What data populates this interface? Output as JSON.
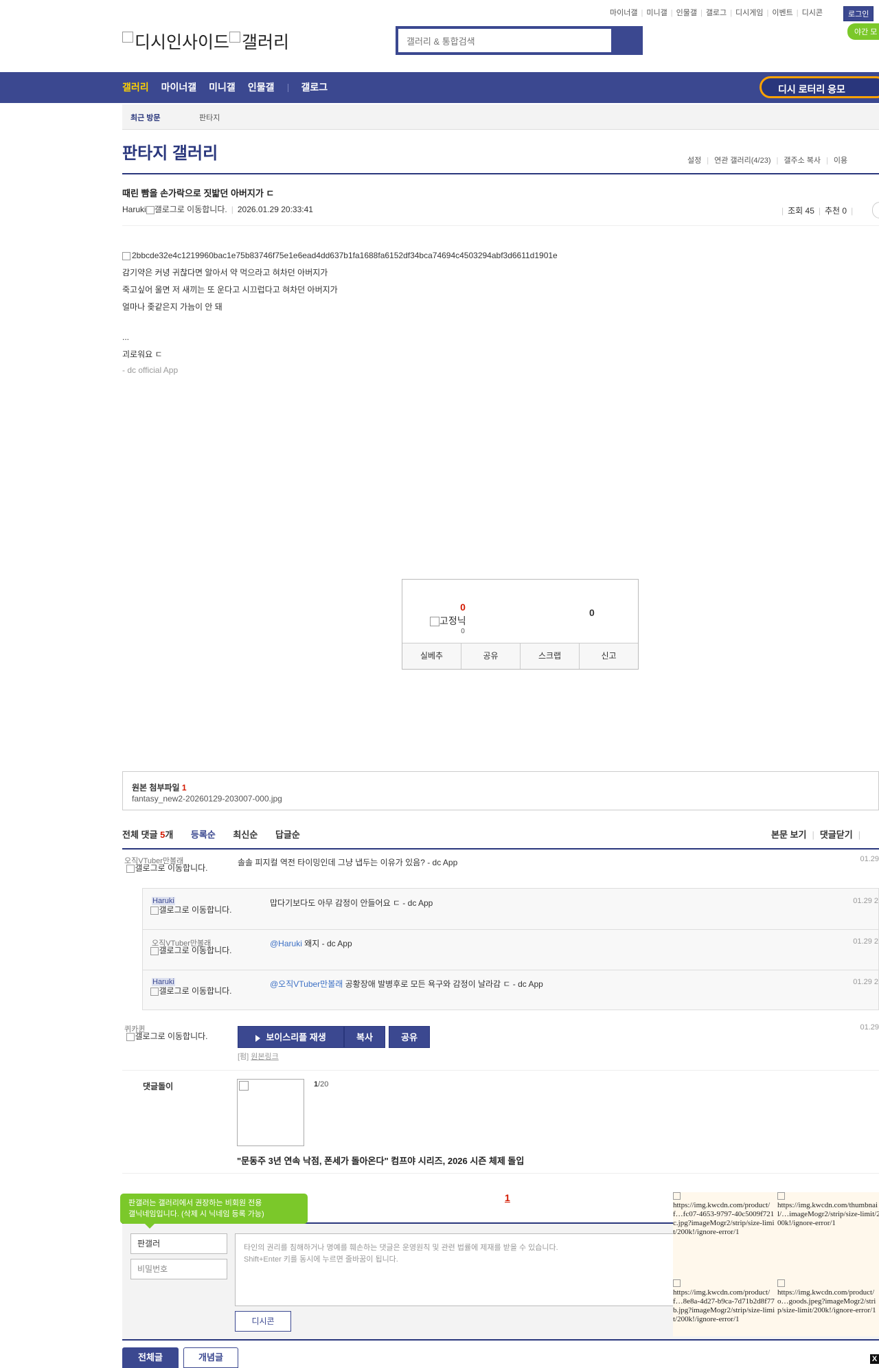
{
  "util_links": [
    "마이너갤",
    "미니갤",
    "인물갤",
    "갤로그",
    "디시게임",
    "이벤트",
    "디시콘"
  ],
  "login_label": "로그인",
  "night_label": "야간 모",
  "logo_text_1": "디시인사이드",
  "logo_text_2": "갤러리",
  "search": {
    "placeholder": "갤러리 & 통합검색"
  },
  "nav": {
    "items": [
      "갤러리",
      "마이너갤",
      "미니갤",
      "인물갤"
    ],
    "gallog": "갤로그",
    "lottery": "디시 로터리 응모"
  },
  "recent_visit": {
    "title": "최근 방문",
    "item": "판타지"
  },
  "gallery": {
    "title": "판타지 갤러리",
    "links": [
      "설정",
      "연관 갤러리(4/23)",
      "갤주소 복사",
      "이용"
    ]
  },
  "post": {
    "title": "때린 빰을 손가락으로 짓밟던 아버지가 ㄷ",
    "author": "Haruki",
    "gallog_alt": "갤로그로 이동합니다.",
    "date": "2026.01.29 20:33:41",
    "views_label": "조회 45",
    "recommend_label": "추천 0",
    "image_alt": "2bbcde32e4c1219960bac1e75b83746f75e1e6ead4dd637b1fa1688fa6152df34bca74694c4503294abf3d6611d1901e",
    "lines": [
      "감기약은 커녕 귀찮다면 알아서 약 먹으라고 혀차던 아버지가",
      "죽고싶어 울면 저 새끼는 또 운다고 시끄럽다고 혀차던 아버지가",
      "얼마나 좆같은지 가늠이 안 돼",
      "",
      "...",
      "괴로워요 ㄷ"
    ],
    "app_signature": "- dc official App"
  },
  "recommend_box": {
    "up_count": "0",
    "nick_label": "고정닉",
    "nick_count": "0",
    "down_count": "0",
    "buttons": [
      "실베추",
      "공유",
      "스크랩",
      "신고"
    ]
  },
  "attachment": {
    "label": "원본 첨부파일",
    "count": "1",
    "filename": "fantasy_new2-20260129-203007-000.jpg"
  },
  "comments_header": {
    "label": "전체 댓글",
    "count": "5",
    "unit": "개",
    "sort": [
      "등록순",
      "최신순",
      "답글순"
    ],
    "right": [
      "본문 보기",
      "댓글닫기"
    ]
  },
  "comments": [
    {
      "nick": "오직VTuber만볼래",
      "gallog": "갤로그로 이동합니다.",
      "text": "솔솔 피지컬 역전 타이밍인데 그냥 냅두는 이유가 있음? - dc App",
      "date": "01.29"
    }
  ],
  "replies": [
    {
      "nick": "Haruki",
      "gallog": "갤로그로 이동합니다.",
      "mention": "",
      "text": "맙다기보다도 아무 감정이 안들어요 ㄷ - dc App",
      "date": "01.29 2"
    },
    {
      "nick": "오직VTuber만볼래",
      "gallog": "갤로그로 이동합니다.",
      "mention": "@Haruki",
      "text": " 왜지 - dc App",
      "date": "01.29 2"
    },
    {
      "nick": "Haruki",
      "gallog": "갤로그로 이동합니다.",
      "mention": "@오직VTuber만볼래",
      "text": " 공황장애 발병후로 모든 욕구와 감정이 날라감 ㄷ - dc App",
      "date": "01.29 2"
    }
  ],
  "voice_comment": {
    "nick": "퀴카퀸",
    "gallog": "갤로그로 이동합니다.",
    "play_label": "보이스리플 재생",
    "copy_label": "복사",
    "share_label": "공유",
    "tag": "[펌]",
    "link_label": "원본링크",
    "date": "01.29"
  },
  "dcbot": {
    "label": "댓글돌이",
    "page": "1",
    "total": "/20",
    "headline": "\"문동주 3년 연속 낙점, 폰세가 돌아온다\" 컴프야 시리즈, 2026 시즌 체제 돌입"
  },
  "comment_page": "1",
  "write": {
    "tooltip": "판갤러는 갤러리에서 권장하는 비회원 전용\n갤닉네임입니다. (삭제 시 닉네임 등록 가능)",
    "nick_value": "판갤러",
    "pw_placeholder": "비밀번호",
    "text_placeholder": "타인의 권리를 침해하거나 명예를 훼손하는 댓글은 운영원칙 및 관련 법률에 제재를 받을 수 있습니다.\nShift+Enter 키를 동시에 누르면 줄바꿈이 됩니다.",
    "dccon_label": "디시콘"
  },
  "bottom_buttons": {
    "all": "전체글",
    "best": "개념글"
  },
  "ads": [
    "https://img.kwcdn.com/product/f…fc07-4653-9797-40c5009f721c.jpg?imageMogr2/strip/size-limit/200k!/ignore-error/1",
    "https://img.kwcdn.com/thumbnail/…imageMogr2/strip/size-limit/200k!/ignore-error/1",
    "https://img.kwcdn.com/product/f…8e8a-4d27-b9ca-7d71b2d8f77b.jpg?imageMogr2/strip/size-limit/200k!/ignore-error/1",
    "https://img.kwcdn.com/product/o…goods.jpeg?imageMogr2/strip/size-limit/200k!/ignore-error/1"
  ],
  "ad_close": "X"
}
